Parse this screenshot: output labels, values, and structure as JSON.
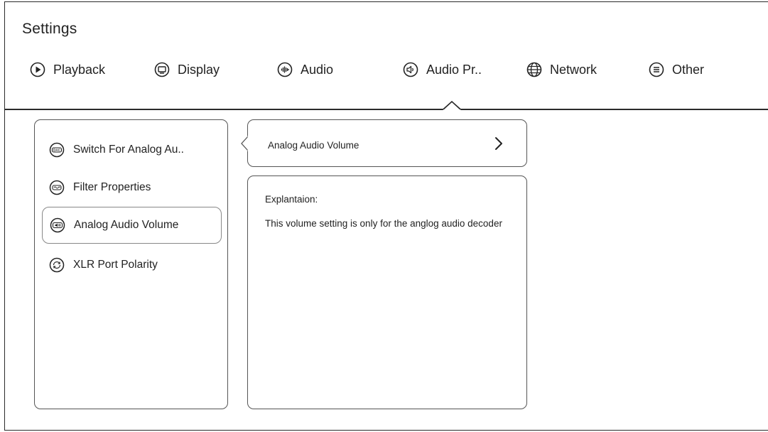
{
  "title": "Settings",
  "tabs": [
    {
      "label": "Playback",
      "icon": "play-circle-icon"
    },
    {
      "label": "Display",
      "icon": "display-icon"
    },
    {
      "label": "Audio",
      "icon": "audio-wave-icon"
    },
    {
      "label": "Audio Pr..",
      "icon": "speaker-icon"
    },
    {
      "label": "Network",
      "icon": "globe-icon"
    },
    {
      "label": "Other",
      "icon": "menu-lines-icon"
    }
  ],
  "menu": [
    {
      "label": "Switch For Analog Au..",
      "icon": "dac-icon"
    },
    {
      "label": "Filter Properties",
      "icon": "filter-icon"
    },
    {
      "label": "Analog Audio Volume",
      "icon": "volume-icon"
    },
    {
      "label": "XLR Port Polarity",
      "icon": "polarity-icon"
    }
  ],
  "selected_menu": "Analog Audio Volume",
  "option": {
    "label": "Analog Audio Volume"
  },
  "explanation": {
    "heading": "Explantaion:",
    "text": "This volume setting is only for the anglog audio decoder"
  }
}
